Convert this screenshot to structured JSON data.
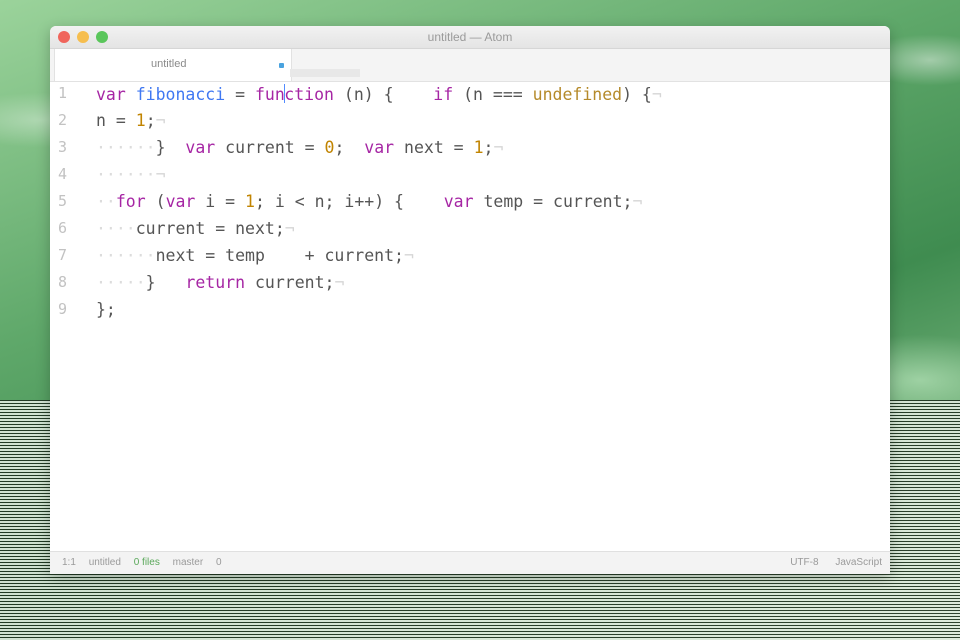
{
  "window": {
    "title": "untitled — Atom"
  },
  "tabs": [
    {
      "label": "untitled",
      "modified": true
    }
  ],
  "editor": {
    "line_numbers": [
      "1",
      "2",
      "3",
      "4",
      "5",
      "6",
      "7",
      "8",
      "9"
    ],
    "lines": [
      [
        {
          "t": "var ",
          "c": "kw"
        },
        {
          "t": "fibonacci",
          "c": "fn"
        },
        {
          "t": " = "
        },
        {
          "t": "fun",
          "c": "kw"
        },
        {
          "t": "|",
          "c": "cursor"
        },
        {
          "t": "ction",
          "c": "kw"
        },
        {
          "t": " (n) {    "
        },
        {
          "t": "if",
          "c": "kw"
        },
        {
          "t": " (n === "
        },
        {
          "t": "undefined",
          "c": "und"
        },
        {
          "t": ") {"
        },
        {
          "t": "¬",
          "c": "inv"
        }
      ],
      [
        {
          "t": "n = "
        },
        {
          "t": "1",
          "c": "num"
        },
        {
          "t": ";"
        },
        {
          "t": "¬",
          "c": "inv"
        }
      ],
      [
        {
          "t": "······",
          "c": "guide"
        },
        {
          "t": "}  "
        },
        {
          "t": "var",
          "c": "kw"
        },
        {
          "t": " current = "
        },
        {
          "t": "0",
          "c": "num"
        },
        {
          "t": ";  "
        },
        {
          "t": "var",
          "c": "kw"
        },
        {
          "t": " next = "
        },
        {
          "t": "1",
          "c": "num"
        },
        {
          "t": ";"
        },
        {
          "t": "¬",
          "c": "inv"
        }
      ],
      [
        {
          "t": "······",
          "c": "guide"
        },
        {
          "t": "¬",
          "c": "inv"
        }
      ],
      [
        {
          "t": "··",
          "c": "guide"
        },
        {
          "t": "for",
          "c": "kw"
        },
        {
          "t": " ("
        },
        {
          "t": "var",
          "c": "kw"
        },
        {
          "t": " i = "
        },
        {
          "t": "1",
          "c": "num"
        },
        {
          "t": "; i < n; i++) {    "
        },
        {
          "t": "var",
          "c": "kw"
        },
        {
          "t": " temp = current;"
        },
        {
          "t": "¬",
          "c": "inv"
        }
      ],
      [
        {
          "t": "····",
          "c": "guide"
        },
        {
          "t": "current = next;"
        },
        {
          "t": "¬",
          "c": "inv"
        }
      ],
      [
        {
          "t": "······",
          "c": "guide"
        },
        {
          "t": "next = temp    + current;"
        },
        {
          "t": "¬",
          "c": "inv"
        }
      ],
      [
        {
          "t": "·····",
          "c": "guide"
        },
        {
          "t": "}   "
        },
        {
          "t": "return",
          "c": "kw"
        },
        {
          "t": " current;"
        },
        {
          "t": "¬",
          "c": "inv"
        }
      ],
      [
        {
          "t": "};"
        }
      ]
    ]
  },
  "statusbar": {
    "left": [
      "1:1",
      "untitled",
      "0 files",
      "master",
      "0"
    ],
    "right": [
      "UTF-8",
      "JavaScript"
    ]
  },
  "colors": {
    "keyword": "#a626a4",
    "function": "#4078f2",
    "number": "#c18401",
    "cursor": "#528bff"
  }
}
